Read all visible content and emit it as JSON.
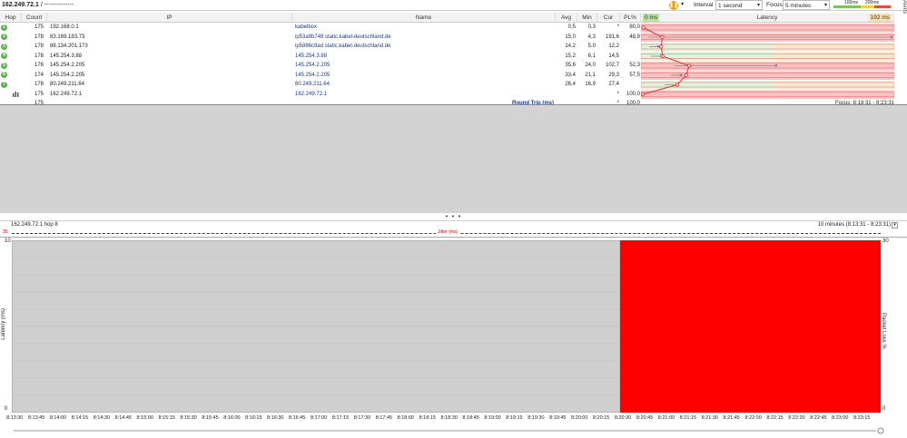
{
  "header": {
    "target": "162.249.72.1",
    "target_suffix": " / ",
    "target_desc": "--------------",
    "interval_label": "Interval",
    "interval_value": "1 second",
    "focus_label": "Focus",
    "focus_value": "5 minutes",
    "scale_100": "100ms",
    "scale_200": "200ms",
    "alerts_label": "Alerts"
  },
  "columns": {
    "hop": "Hop",
    "count": "Count",
    "ip": "IP",
    "name": "Name",
    "avg": "Avg",
    "min": "Min",
    "cur": "Cur",
    "pl": "PL%",
    "latency_min": "0 ms",
    "latency": "Latency",
    "latency_max": "192 ms"
  },
  "hops": [
    {
      "hop": "1",
      "count": "175",
      "ip": "192.168.0.1",
      "name": "kabelbox",
      "avg": "0,5",
      "min": "0,3",
      "cur": "*",
      "pl": "80,0",
      "avg_ms": 0.5,
      "min_ms": 0.3,
      "cur_ms": null,
      "pl_value": 80.0
    },
    {
      "hop": "2",
      "count": "178",
      "ip": "83.169.183.73",
      "name": "ip53a9b749.static.kabel-deutschland.de",
      "avg": "15,0",
      "min": "4,3",
      "cur": "191,6",
      "pl": "48,9",
      "avg_ms": 15.0,
      "min_ms": 4.3,
      "cur_ms": 191.6,
      "pl_value": 48.9
    },
    {
      "hop": "3",
      "count": "178",
      "ip": "88.134.201.173",
      "name": "ip5886c9ad.static.kabel-deutschland.de",
      "avg": "14,2",
      "min": "5,0",
      "cur": "12,2",
      "pl": "",
      "avg_ms": 14.2,
      "min_ms": 5.0,
      "cur_ms": 12.2,
      "pl_value": 0
    },
    {
      "hop": "4",
      "count": "178",
      "ip": "145.254.3.88",
      "name": "145.254.3.88",
      "avg": "15,2",
      "min": "6,1",
      "cur": "14,5",
      "pl": "",
      "avg_ms": 15.2,
      "min_ms": 6.1,
      "cur_ms": 14.5,
      "pl_value": 0
    },
    {
      "hop": "5",
      "count": "176",
      "ip": "145.254.2.205",
      "name": "145.254.2.205",
      "avg": "35,6",
      "min": "24,0",
      "cur": "102,7",
      "pl": "52,3",
      "avg_ms": 35.6,
      "min_ms": 24.0,
      "cur_ms": 102.7,
      "pl_value": 52.3
    },
    {
      "hop": "6",
      "count": "174",
      "ip": "145.254.2.205",
      "name": "145.254.2.205",
      "avg": "33,4",
      "min": "21,1",
      "cur": "29,3",
      "pl": "57,5",
      "avg_ms": 33.4,
      "min_ms": 21.1,
      "cur_ms": 29.3,
      "pl_value": 57.5
    },
    {
      "hop": "7",
      "count": "178",
      "ip": "80.249.211.64",
      "name": "80.249.211.64",
      "avg": "26,4",
      "min": "16,9",
      "cur": "27,4",
      "pl": "",
      "avg_ms": 26.4,
      "min_ms": 16.9,
      "cur_ms": 27.4,
      "pl_value": 0
    },
    {
      "hop": "",
      "count": "175",
      "ip": "162.249.72.1",
      "name": "162.249.72.1",
      "avg": "",
      "min": "",
      "cur": "*",
      "pl": "100,0",
      "avg_ms": null,
      "min_ms": null,
      "cur_ms": null,
      "pl_value": 100.0
    }
  ],
  "totals": {
    "count": "175",
    "label": "Round Trip (ms)",
    "cur": "*",
    "pl": "100,0",
    "focus": "Focus: 8:18:31 - 8:23:31"
  },
  "graph": {
    "title": "162.249.72.1 hop 8",
    "range": "10 minutes (8:13:31 - 8:23:31)",
    "jitter_label": "Jitter (ms)",
    "jitter_scale": "35",
    "ylabel": "Latency (ms)",
    "y2label": "Packet Loss %",
    "y_top": "10",
    "y_bottom": "0",
    "y2_top": "30",
    "y2_bottom": "0",
    "loss_start_index": 28
  },
  "chart_data": {
    "type": "area",
    "title": "162.249.72.1 hop 8",
    "xlabel": "",
    "ylabel": "Latency (ms)",
    "x": [
      "8:13:30",
      "8:13:45",
      "8:14:00",
      "8:14:15",
      "8:14:30",
      "8:14:45",
      "8:15:00",
      "8:15:15",
      "8:15:30",
      "8:15:45",
      "8:16:00",
      "8:16:15",
      "8:16:30",
      "8:16:45",
      "8:17:00",
      "8:17:15",
      "8:17:30",
      "8:17:45",
      "8:18:00",
      "8:18:15",
      "8:18:30",
      "8:18:45",
      "8:19:00",
      "8:19:15",
      "8:19:30",
      "8:19:45",
      "8:20:00",
      "8:20:15",
      "8:20:30",
      "8:20:45",
      "8:21:00",
      "8:21:15",
      "8:21:30",
      "8:21:45",
      "8:22:00",
      "8:22:15",
      "8:22:30",
      "8:22:45",
      "8:23:00",
      "8:23:15"
    ],
    "ylim": [
      0,
      10
    ],
    "y2lim": [
      0,
      30
    ],
    "series": [
      {
        "name": "Packet Loss %",
        "values": [
          0,
          0,
          0,
          0,
          0,
          0,
          0,
          0,
          0,
          0,
          0,
          0,
          0,
          0,
          0,
          0,
          0,
          0,
          0,
          0,
          0,
          0,
          0,
          0,
          0,
          0,
          0,
          0,
          100,
          100,
          100,
          100,
          100,
          100,
          100,
          100,
          100,
          100,
          100,
          100
        ]
      }
    ]
  }
}
